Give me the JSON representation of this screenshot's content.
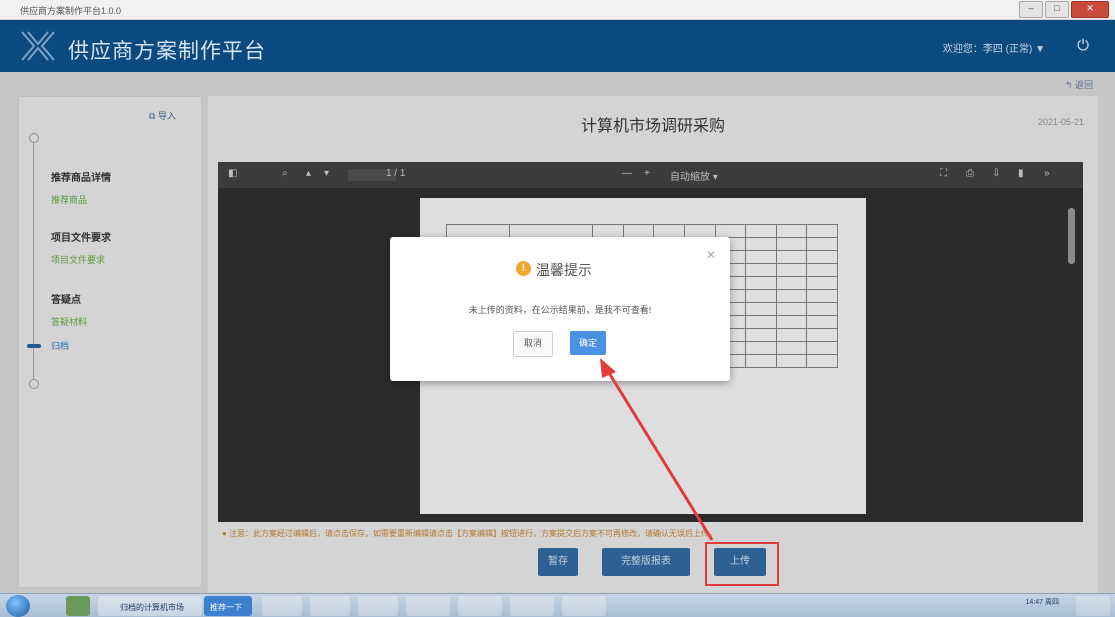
{
  "window": {
    "title": "供应商方案制作平台1.0.0"
  },
  "header": {
    "app_title": "供应商方案制作平台",
    "user": "欢迎您：李四 (正常) ▼",
    "back_label": "返回"
  },
  "sidebar": {
    "export_label": "导入",
    "steps": [
      {
        "title": "推荐商品详情",
        "sub": "推荐商品"
      },
      {
        "title": "项目文件要求",
        "sub": "项目文件要求"
      },
      {
        "title": "答疑点",
        "sub": "答疑材料"
      }
    ],
    "active_step": "归档"
  },
  "document": {
    "title": "计算机市场调研采购",
    "date": "2021-05-21"
  },
  "pdf_toolbar": {
    "page_indicator": "1 / 1",
    "zoom": "自动缩放"
  },
  "notice": "● 注意：此方案经过编辑后，请点击保存，如需要重新编辑请点击【方案编辑】按钮进行，方案提交后方案不可再修改，请确认无误后上传。",
  "buttons": {
    "save": "暂存",
    "preview": "完整版报表",
    "upload": "上传"
  },
  "modal": {
    "title": "温馨提示",
    "message": "未上传的资料，在公示结果前，是我不可查看!",
    "cancel": "取消",
    "ok": "确定"
  },
  "taskbar": {
    "ie_label": "归档的计算机市场",
    "active_task": "推荐一下",
    "time": "14:47 周四"
  }
}
